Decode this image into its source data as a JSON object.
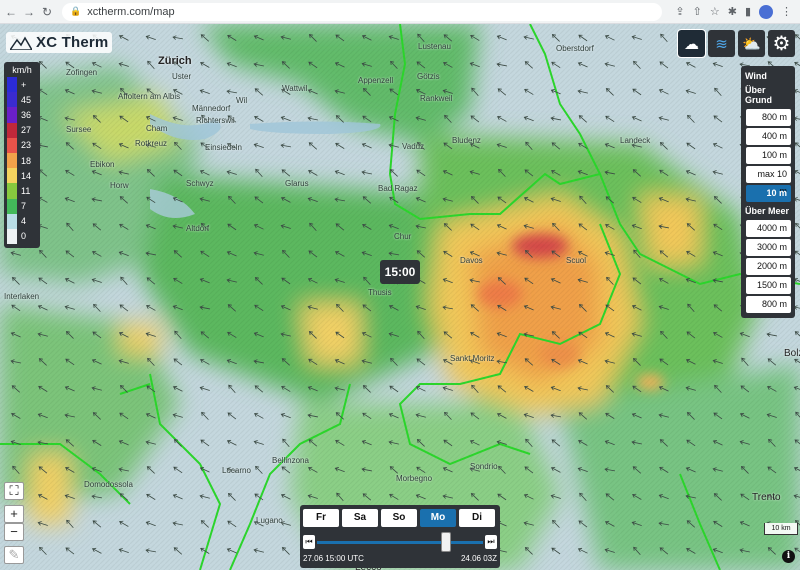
{
  "browser": {
    "url": "xctherm.com/map",
    "nav_back": "←",
    "nav_forward": "→",
    "nav_reload": "↻",
    "lock": "🔒",
    "icons": [
      "share-icon",
      "upload-icon",
      "star-icon",
      "extensions-icon",
      "sidebar-icon",
      "avatar",
      "menu-icon"
    ]
  },
  "app": {
    "name": "XC Therm",
    "time_label": "15:00"
  },
  "legend": {
    "unit": "km/h",
    "entries": [
      {
        "label": "+",
        "color": "#2b2bd8"
      },
      {
        "label": "45",
        "color": "#3a2bd0"
      },
      {
        "label": "36",
        "color": "#6a1fc8"
      },
      {
        "label": "27",
        "color": "#c0283a"
      },
      {
        "label": "23",
        "color": "#e8534a"
      },
      {
        "label": "18",
        "color": "#f3a24a"
      },
      {
        "label": "14",
        "color": "#f4d35e"
      },
      {
        "label": "11",
        "color": "#87c93e"
      },
      {
        "label": "7",
        "color": "#43b95a"
      },
      {
        "label": "4",
        "color": "#b9dde6"
      },
      {
        "label": "0",
        "color": "#eef2f4"
      }
    ]
  },
  "toolbar": {
    "buttons": [
      {
        "name": "thermal-cloud-layer-button",
        "glyph": "☁",
        "active": true
      },
      {
        "name": "wind-layer-button",
        "glyph": "≋",
        "active": false
      },
      {
        "name": "weather-layer-button",
        "glyph": "⛅",
        "active": false
      },
      {
        "name": "settings-button",
        "glyph": "⚙",
        "active": false
      }
    ]
  },
  "altitude_panel": {
    "title": "Wind",
    "group_ground": "Über Grund",
    "ground_options": [
      "800 m",
      "400 m",
      "100 m",
      "max 10 m",
      "10 m"
    ],
    "selected": "10 m",
    "group_sea": "Über Meer",
    "sea_options": [
      "4000 m",
      "3000 m",
      "2000 m",
      "1500 m",
      "800 m"
    ]
  },
  "zoom": {
    "fullscreen": "⛶",
    "zoom_in": "+",
    "zoom_out": "−",
    "draw": "✎"
  },
  "time_panel": {
    "days": [
      "Fr",
      "Sa",
      "So",
      "Mo",
      "Di"
    ],
    "selected_day": "Mo",
    "start_label": "27.06 15:00 UTC",
    "end_label": "24.06 03Z",
    "prev": "⏮",
    "next": "⏭",
    "position": 0.78
  },
  "scale": {
    "label": "10 km"
  },
  "info": {
    "label": "i"
  },
  "places": {
    "zurich": "Zürich",
    "uster": "Uster",
    "wil": "Wil",
    "appenzell": "Appenzell",
    "lustenau": "Lustenau",
    "oberstdorf": "Oberstdorf",
    "vaduz": "Vaduz",
    "chur": "Chur",
    "davos": "Davos",
    "flims": "Flims",
    "bad_ragaz": "Bad Ragaz",
    "bludenz": "Bludenz",
    "landeck": "Landeck",
    "scuol": "Scuol",
    "thusis": "Thusis",
    "st_moritz": "Sankt Moritz",
    "bellinzona": "Bellinzona",
    "locarno": "Locarno",
    "lugano": "Lugano",
    "domodossola": "Domodossola",
    "sondrio": "Sondrio",
    "morbegno": "Morbegno",
    "trento": "Trento",
    "bolzano": "Bolz",
    "lecco": "Lecco",
    "interlaken": "Interlaken",
    "sursee": "Sursee",
    "cham": "Cham",
    "schwyz": "Schwyz",
    "glarus": "Glarus",
    "altdorf": "Altdorf",
    "horw": "Horw",
    "einsiedeln": "Einsiedeln",
    "ebikon": "Ebikon",
    "affoltern": "Affoltern am Albis",
    "wadenswil": "Wädenswil",
    "richterswil": "Richterswil",
    "mannedorf": "Männedorf",
    "rankweil": "Rankweil",
    "gotzis": "Götzis",
    "wattwil": "Wattwil",
    "zofingen": "Zofingen",
    "rothkreuz": "Rotkreuz"
  }
}
